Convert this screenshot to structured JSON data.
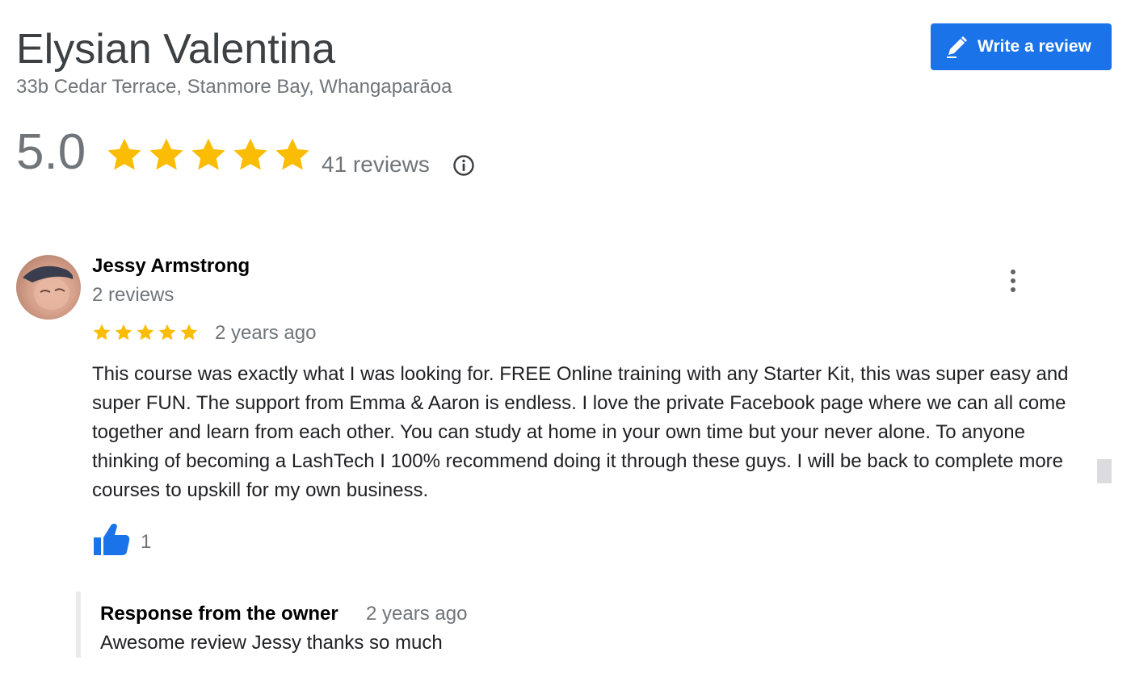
{
  "business": {
    "name": "Elysian Valentina",
    "address": "33b Cedar Terrace, Stanmore Bay, Whangaparāoa"
  },
  "write_review": {
    "label": "Write a review",
    "icon": "pencil-icon"
  },
  "summary": {
    "rating": "5.0",
    "stars": 5,
    "review_count": "41 reviews",
    "info_icon": "info-icon",
    "star_color": "#fbbc04"
  },
  "review": {
    "reviewer_name": "Jessy Armstrong",
    "reviewer_review_count": "2 reviews",
    "stars": 5,
    "time": "2 years ago",
    "text": "This course was exactly what I was looking for. FREE Online training with any Starter Kit, this was super easy and super FUN. The support from Emma & Aaron is endless. I love the private Facebook page where we can all come together and learn from each other. You can study at home in your own time but your never alone. To anyone thinking of becoming a LashTech  I 100% recommend doing it through these guys. I will be back to complete more courses to upskill for my own business.",
    "likes": "1",
    "like_icon": "thumbs-up-icon",
    "more_icon": "more-vert-icon"
  },
  "owner_response": {
    "title": "Response from the owner",
    "time": "2 years ago",
    "text": "Awesome review Jessy thanks so much"
  },
  "colors": {
    "accent": "#1a73e8",
    "muted_text": "#70757a",
    "star": "#fbbc04"
  }
}
